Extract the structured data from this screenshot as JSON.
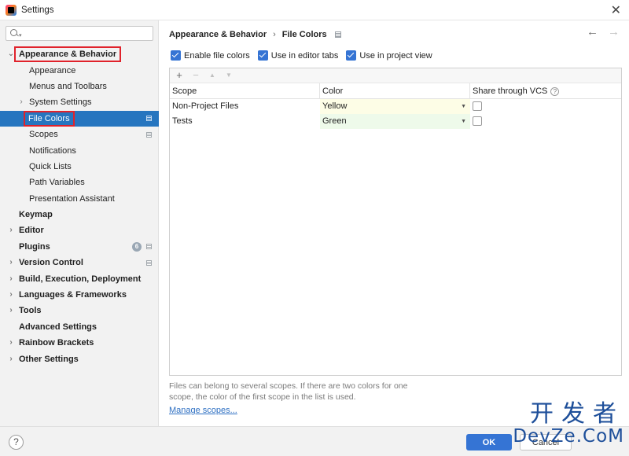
{
  "window": {
    "title": "Settings"
  },
  "search": {
    "placeholder": "",
    "value": ""
  },
  "sidebar": {
    "items": [
      {
        "label": "Appearance & Behavior",
        "level": 0,
        "expanded": true,
        "bold": true
      },
      {
        "label": "Appearance",
        "level": 1
      },
      {
        "label": "Menus and Toolbars",
        "level": 1
      },
      {
        "label": "System Settings",
        "level": 1,
        "collapsed": true
      },
      {
        "label": "File Colors",
        "level": 1,
        "selected": true
      },
      {
        "label": "Scopes",
        "level": 1
      },
      {
        "label": "Notifications",
        "level": 1
      },
      {
        "label": "Quick Lists",
        "level": 1
      },
      {
        "label": "Path Variables",
        "level": 1
      },
      {
        "label": "Presentation Assistant",
        "level": 1
      },
      {
        "label": "Keymap",
        "level": 0,
        "bold": true
      },
      {
        "label": "Editor",
        "level": 0,
        "bold": true,
        "collapsed": true
      },
      {
        "label": "Plugins",
        "level": 0,
        "bold": true,
        "badge": "6"
      },
      {
        "label": "Version Control",
        "level": 0,
        "bold": true,
        "collapsed": true
      },
      {
        "label": "Build, Execution, Deployment",
        "level": 0,
        "bold": true,
        "collapsed": true
      },
      {
        "label": "Languages & Frameworks",
        "level": 0,
        "bold": true,
        "collapsed": true
      },
      {
        "label": "Tools",
        "level": 0,
        "bold": true,
        "collapsed": true
      },
      {
        "label": "Advanced Settings",
        "level": 0,
        "bold": true
      },
      {
        "label": "Rainbow Brackets",
        "level": 0,
        "bold": true,
        "collapsed": true
      },
      {
        "label": "Other Settings",
        "level": 0,
        "bold": true,
        "collapsed": true
      }
    ]
  },
  "breadcrumb": {
    "parent": "Appearance & Behavior",
    "separator": "›",
    "current": "File Colors"
  },
  "options": {
    "enable_file_colors": "Enable file colors",
    "use_in_editor_tabs": "Use in editor tabs",
    "use_in_project_view": "Use in project view"
  },
  "table": {
    "headers": {
      "scope": "Scope",
      "color": "Color",
      "share": "Share through VCS"
    },
    "rows": [
      {
        "scope": "Non-Project Files",
        "color": "Yellow",
        "color_hex": "#fdfde6",
        "shared": false
      },
      {
        "scope": "Tests",
        "color": "Green",
        "color_hex": "#eefaea",
        "shared": false
      }
    ]
  },
  "description": "Files can belong to several scopes. If there are two colors for one scope, the color of the first scope in the list is used.",
  "manage_scopes": "Manage scopes...",
  "footer": {
    "help": "?",
    "ok": "OK",
    "cancel": "Cancel"
  },
  "watermark": {
    "line1": "开发者",
    "line2": "DevZe.CoM"
  },
  "colors": {
    "accent": "#3574d4",
    "selection": "#2675bf",
    "highlight": "#e0222b"
  }
}
